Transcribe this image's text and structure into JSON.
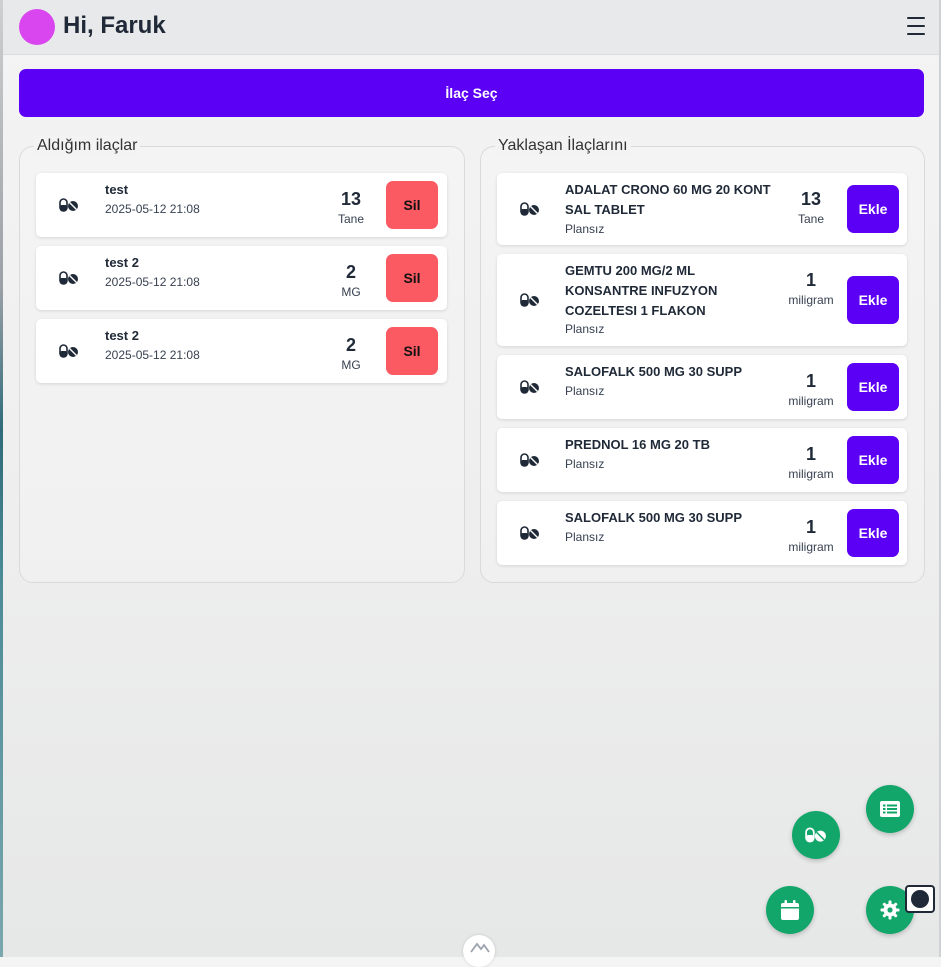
{
  "header": {
    "greeting": "Hi, Faruk",
    "avatar_color": "#d946ef",
    "menu_icon": "hamburger-menu-icon"
  },
  "select_button": {
    "label": "İlaç Seç",
    "color": "#5b00f5"
  },
  "taken": {
    "title": "Aldığım ilaçlar",
    "items": [
      {
        "name": "test",
        "datetime": "2025-05-12 21:08",
        "quantity": "13",
        "unit": "Tane",
        "action": "Sil"
      },
      {
        "name": "test 2",
        "datetime": "2025-05-12 21:08",
        "quantity": "2",
        "unit": "MG",
        "action": "Sil"
      },
      {
        "name": "test 2",
        "datetime": "2025-05-12 21:08",
        "quantity": "2",
        "unit": "MG",
        "action": "Sil"
      }
    ]
  },
  "upcoming": {
    "title": "Yaklaşan İlaçlarını",
    "items": [
      {
        "name_lines": [
          "ADALAT CRONO 60 MG 20 KONT",
          "SAL TABLET"
        ],
        "plan": "Plansız",
        "quantity": "13",
        "unit": "Tane",
        "action": "Ekle"
      },
      {
        "name_lines": [
          "GEMTU 200 MG/2 ML",
          "KONSANTRE INFUZYON",
          "COZELTESI 1 FLAKON"
        ],
        "plan": "Plansız",
        "quantity": "1",
        "unit": "miligram",
        "action": "Ekle"
      },
      {
        "name_lines": [
          "SALOFALK 500 MG 30 SUPP"
        ],
        "plan": "Plansız",
        "quantity": "1",
        "unit": "miligram",
        "action": "Ekle"
      },
      {
        "name_lines": [
          "PREDNOL 16 MG 20 TB"
        ],
        "plan": "Plansız",
        "quantity": "1",
        "unit": "miligram",
        "action": "Ekle"
      },
      {
        "name_lines": [
          "SALOFALK 500 MG 30 SUPP"
        ],
        "plan": "Plansız",
        "quantity": "1",
        "unit": "miligram",
        "action": "Ekle"
      }
    ]
  },
  "fab_menu": {
    "color": "#12a66a",
    "buttons": [
      "list-icon",
      "pills-icon",
      "calendar-icon",
      "gear-icon"
    ],
    "toggle": "fab-toggle"
  },
  "colors": {
    "delete": "#fb5a63",
    "add": "#5b00f5"
  }
}
